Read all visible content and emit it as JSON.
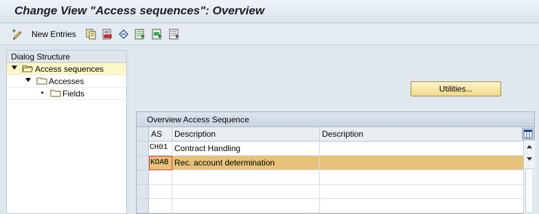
{
  "window": {
    "title": "Change View \"Access sequences\": Overview"
  },
  "toolbar": {
    "new_entries_label": "New Entries",
    "icons": [
      "edit-pencil-icon",
      "copy-icon",
      "delete-icon",
      "undo-icon",
      "select-all-icon",
      "select-block-icon",
      "deselect-all-icon"
    ]
  },
  "dialog_structure": {
    "header": "Dialog Structure",
    "items": [
      {
        "label": "Access sequences",
        "level": 0,
        "expanded": true,
        "selected": true
      },
      {
        "label": "Accesses",
        "level": 1,
        "expanded": true,
        "selected": false
      },
      {
        "label": "Fields",
        "level": 2,
        "expanded": false,
        "selected": false
      }
    ]
  },
  "utilities": {
    "label": "Utilities..."
  },
  "table": {
    "title": "Overview Access Sequence",
    "columns": [
      "AS",
      "Description",
      "Description"
    ],
    "rows": [
      {
        "as": "CH01",
        "desc": "Contract Handling",
        "desc2": ""
      },
      {
        "as": "KOAB",
        "desc": "Rec. account determination",
        "desc2": ""
      }
    ]
  },
  "colors": {
    "selected_row": "#e7c37a",
    "tree_selected": "#fdf7c8",
    "button_gold": "#f3d98a"
  }
}
